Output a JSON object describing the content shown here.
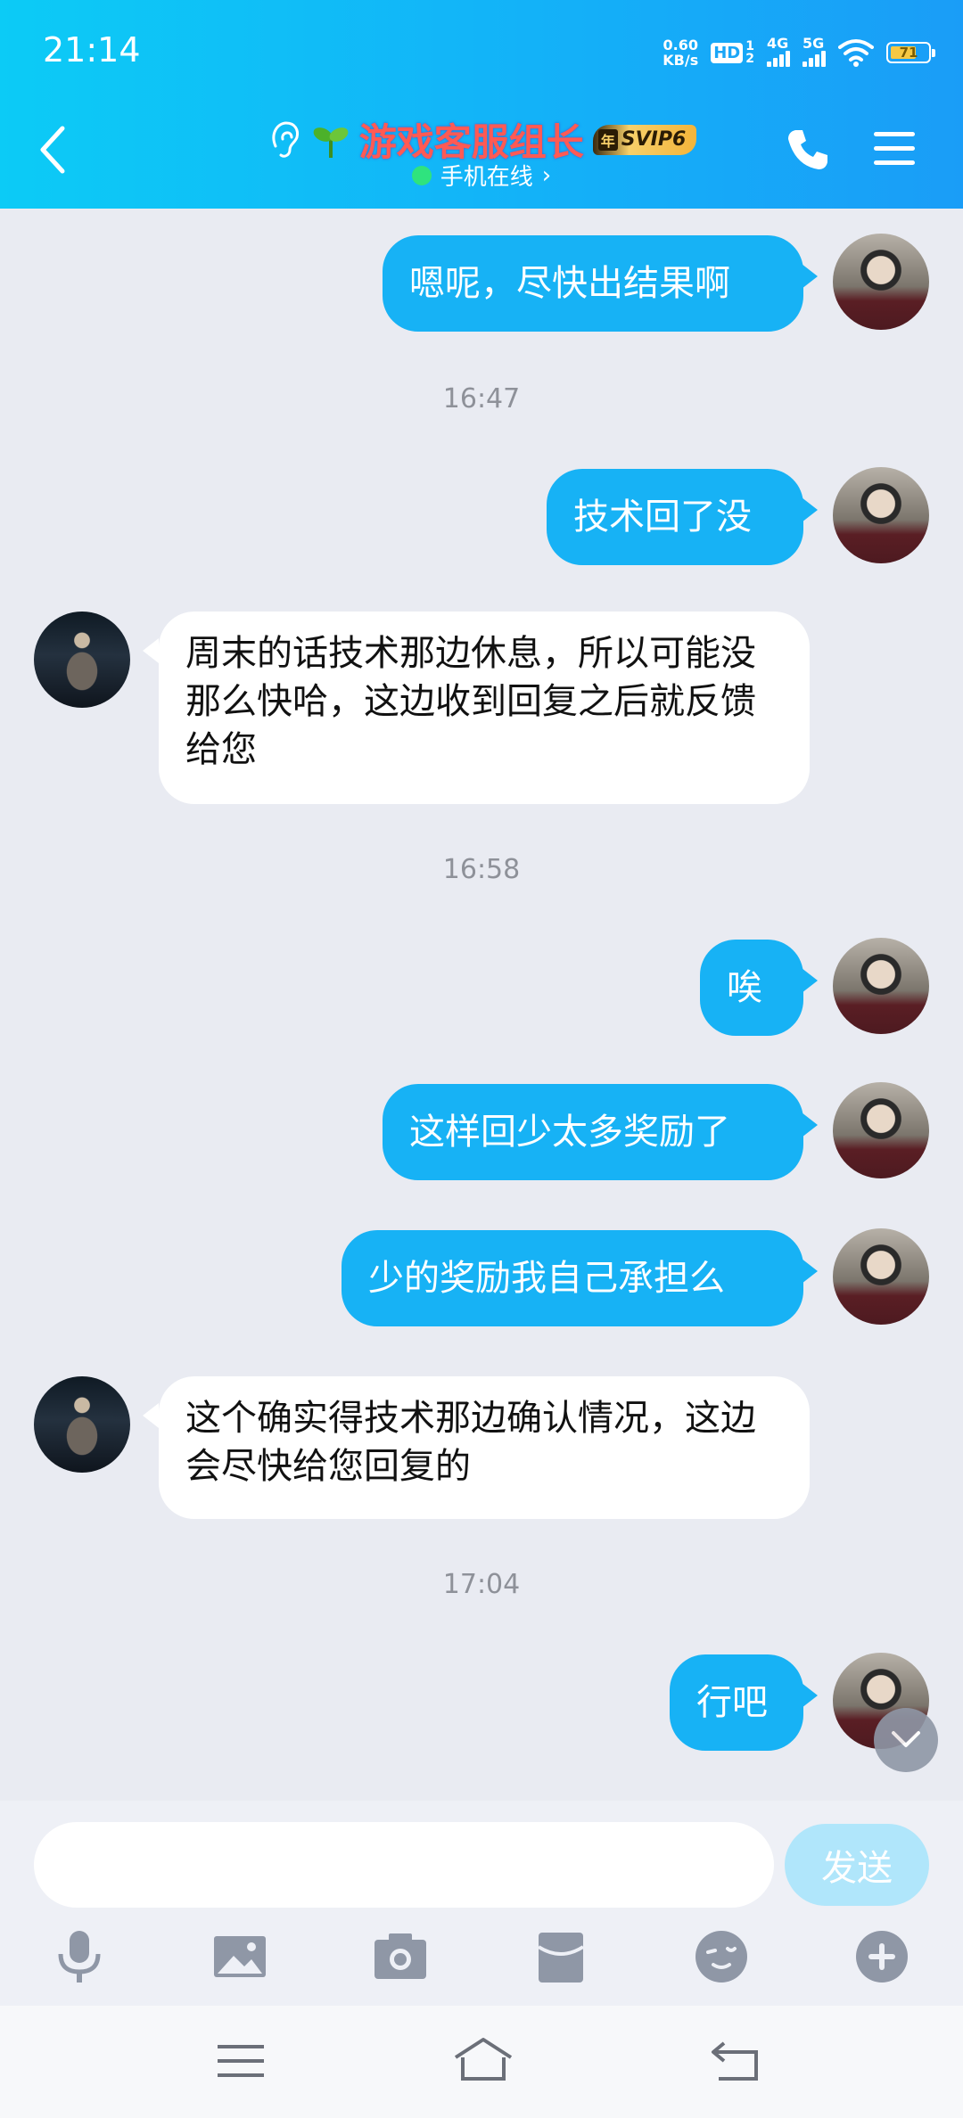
{
  "status_bar": {
    "time": "21:14",
    "net_speed_value": "0.60",
    "net_speed_unit": "KB/s",
    "hd": "HD",
    "hd_sub_top": "1",
    "hd_sub_bottom": "2",
    "signal_1": "4G",
    "signal_2": "5G",
    "battery": "71"
  },
  "header": {
    "title": "游戏客服组长",
    "vip_year": "年",
    "vip_label": "SVIP6",
    "online_status": "手机在线",
    "online_chevron": "›"
  },
  "messages": [
    {
      "side": "out",
      "text": "嗯呢，尽快出结果啊"
    },
    {
      "type": "time",
      "text": "16:47"
    },
    {
      "side": "out",
      "text": "技术回了没"
    },
    {
      "side": "in",
      "text": "周末的话技术那边休息，所以可能没那么快哈，这边收到回复之后就反馈给您"
    },
    {
      "type": "time",
      "text": "16:58"
    },
    {
      "side": "out",
      "text": "唉"
    },
    {
      "side": "out",
      "text": "这样回少太多奖励了"
    },
    {
      "side": "out",
      "text": "少的奖励我自己承担么"
    },
    {
      "side": "in",
      "text": "这个确实得技术那边确认情况，这边会尽快给您回复的"
    },
    {
      "type": "time",
      "text": "17:04"
    },
    {
      "side": "out",
      "text": "行吧"
    }
  ],
  "input": {
    "value": "",
    "send_label": "发送"
  },
  "colors": {
    "header_start": "#0ccbf6",
    "header_end": "#1a9df7",
    "outgoing_bubble": "#17b2f5",
    "incoming_bubble": "#ffffff",
    "background": "#e9ebf2",
    "send_disabled": "#b0e6fb",
    "title_color": "#ff5a54"
  },
  "toolbar_icons": [
    "microphone-icon",
    "image-icon",
    "camera-icon",
    "red-packet-icon",
    "emoji-icon",
    "plus-icon"
  ],
  "nav_icons": [
    "menu-icon",
    "home-icon",
    "back-icon"
  ]
}
